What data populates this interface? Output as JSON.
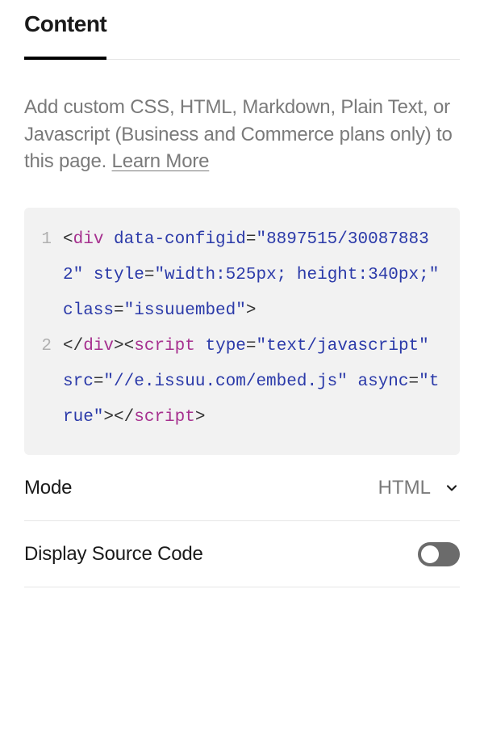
{
  "tab": {
    "label": "Content"
  },
  "description": {
    "text_before": "Add custom CSS, HTML, Markdown, Plain Text, or Javascript (Business and Commerce plans only) to this page. ",
    "learn_more": "Learn More"
  },
  "code": {
    "lines": [
      {
        "num": "1",
        "tokens": [
          {
            "t": "punct",
            "v": "<"
          },
          {
            "t": "tag",
            "v": "div"
          },
          {
            "t": "plain",
            "v": " "
          },
          {
            "t": "attr",
            "v": "data-configid"
          },
          {
            "t": "punct",
            "v": "="
          },
          {
            "t": "str",
            "v": "\"8897515/300878832\""
          },
          {
            "t": "plain",
            "v": " "
          },
          {
            "t": "attr",
            "v": "style"
          },
          {
            "t": "punct",
            "v": "="
          },
          {
            "t": "str",
            "v": "\"width:525px; height:340px;\""
          },
          {
            "t": "plain",
            "v": " "
          },
          {
            "t": "attr",
            "v": "class"
          },
          {
            "t": "punct",
            "v": "="
          },
          {
            "t": "str",
            "v": "\"issuuembed\""
          },
          {
            "t": "punct",
            "v": ">"
          }
        ]
      },
      {
        "num": "2",
        "tokens": [
          {
            "t": "punct",
            "v": "</"
          },
          {
            "t": "tag",
            "v": "div"
          },
          {
            "t": "punct",
            "v": ">"
          },
          {
            "t": "punct",
            "v": "<"
          },
          {
            "t": "tag",
            "v": "script"
          },
          {
            "t": "plain",
            "v": " "
          },
          {
            "t": "attr",
            "v": "type"
          },
          {
            "t": "punct",
            "v": "="
          },
          {
            "t": "str",
            "v": "\"text/javascript\""
          },
          {
            "t": "plain",
            "v": " "
          },
          {
            "t": "attr",
            "v": "src"
          },
          {
            "t": "punct",
            "v": "="
          },
          {
            "t": "str",
            "v": "\"//e.issuu.com/embed.js\""
          },
          {
            "t": "plain",
            "v": " "
          },
          {
            "t": "attr",
            "v": "async"
          },
          {
            "t": "punct",
            "v": "="
          },
          {
            "t": "str",
            "v": "\"true\""
          },
          {
            "t": "punct",
            "v": ">"
          },
          {
            "t": "punct",
            "v": "</"
          },
          {
            "t": "tag",
            "v": "script"
          },
          {
            "t": "punct",
            "v": ">"
          }
        ]
      }
    ]
  },
  "settings": {
    "mode": {
      "label": "Mode",
      "value": "HTML"
    },
    "display_source": {
      "label": "Display Source Code",
      "value": false
    }
  }
}
